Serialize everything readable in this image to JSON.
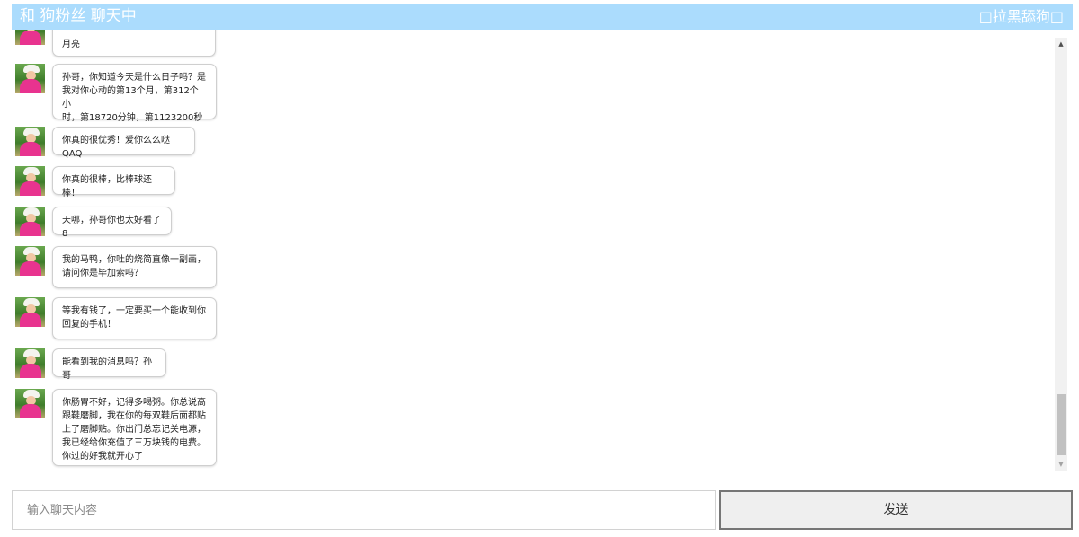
{
  "header": {
    "title": "和 狗粉丝 聊天中",
    "block_action": "□拉黑舔狗□"
  },
  "messages": [
    {
      "text": "月亮"
    },
    {
      "text": "孙哥，你知道今天是什么日子吗？是\n我对你心动的第13个月，第312个小\n时，第18720分钟，第1123200秒"
    },
    {
      "text": "你真的很优秀！爱你么么哒QAQ"
    },
    {
      "text": "你真的很棒，比棒球还棒！"
    },
    {
      "text": "天哪，孙哥你也太好看了8"
    },
    {
      "text": "我的马鸭，你吐的烧简直像一副画，\n请问你是毕加索吗？"
    },
    {
      "text": "等我有钱了，一定要买一个能收到你\n回复的手机！"
    },
    {
      "text": "能看到我的消息吗？孙哥"
    },
    {
      "text": "你肠胃不好，记得多喝粥。你总说高\n跟鞋磨脚，我在你的每双鞋后面都贴\n上了磨脚贴。你出门总忘记关电源，\n我已经给你充值了三万块钱的电费。\n你过的好我就开心了"
    }
  ],
  "scrollbar": {
    "up_arrow": "▲",
    "down_arrow": "▼"
  },
  "composer": {
    "placeholder": "输入聊天内容",
    "value": "",
    "send_label": "发送"
  }
}
